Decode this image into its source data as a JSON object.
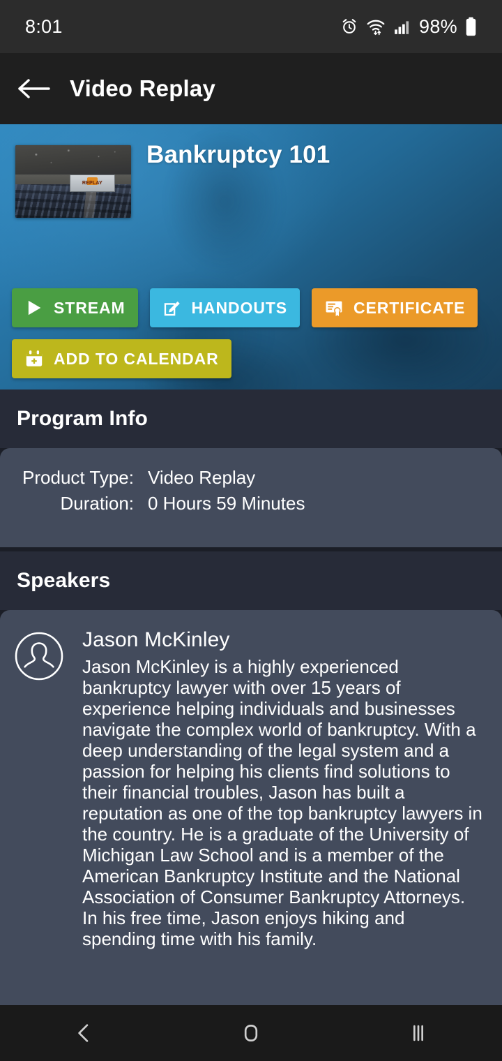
{
  "status_bar": {
    "time": "8:01",
    "battery_percent": "98%",
    "icons": [
      "alarm-icon",
      "wifi-icon",
      "cellular-signal-icon",
      "battery-icon"
    ]
  },
  "app_bar": {
    "back_icon": "back-arrow-icon",
    "title": "Video Replay"
  },
  "hero": {
    "title": "Bankruptcy 101",
    "thumbnail_alt": "auditorium-thumbnail",
    "thumbnail_screen_text": "REPLAY",
    "background_color": "#2a7cb0"
  },
  "actions": [
    {
      "label": "STREAM",
      "icon": "play-icon",
      "color": "#4a9e43"
    },
    {
      "label": "HANDOUTS",
      "icon": "edit-square-icon",
      "color": "#3bb8e0"
    },
    {
      "label": "CERTIFICATE",
      "icon": "certificate-icon",
      "color": "#eb9a29"
    },
    {
      "label": "ADD TO CALENDAR",
      "icon": "calendar-plus-icon",
      "color": "#bdb71c"
    }
  ],
  "program_info": {
    "heading": "Program Info",
    "rows": [
      {
        "label": "Product Type:",
        "value": "Video Replay"
      },
      {
        "label": "Duration:",
        "value": "0 Hours 59 Minutes"
      }
    ]
  },
  "speakers": {
    "heading": "Speakers",
    "list": [
      {
        "avatar_icon": "user-avatar-icon",
        "name": "Jason McKinley",
        "bio": "Jason McKinley is a highly experienced bankruptcy lawyer with over 15 years of experience helping individuals and businesses navigate the complex world of bankruptcy. With a deep understanding of the legal system and a passion for helping his clients find solutions to their financial troubles, Jason has built a reputation as one of the top bankruptcy lawyers in the country. He is a graduate of the University of Michigan Law School and is a member of the American Bankruptcy Institute and the National Association of Consumer Bankruptcy Attorneys. In his free time, Jason enjoys hiking and spending time with his family."
      }
    ]
  },
  "nav_bar": {
    "back": "nav-back-icon",
    "home": "nav-home-icon",
    "recents": "nav-recents-icon"
  }
}
